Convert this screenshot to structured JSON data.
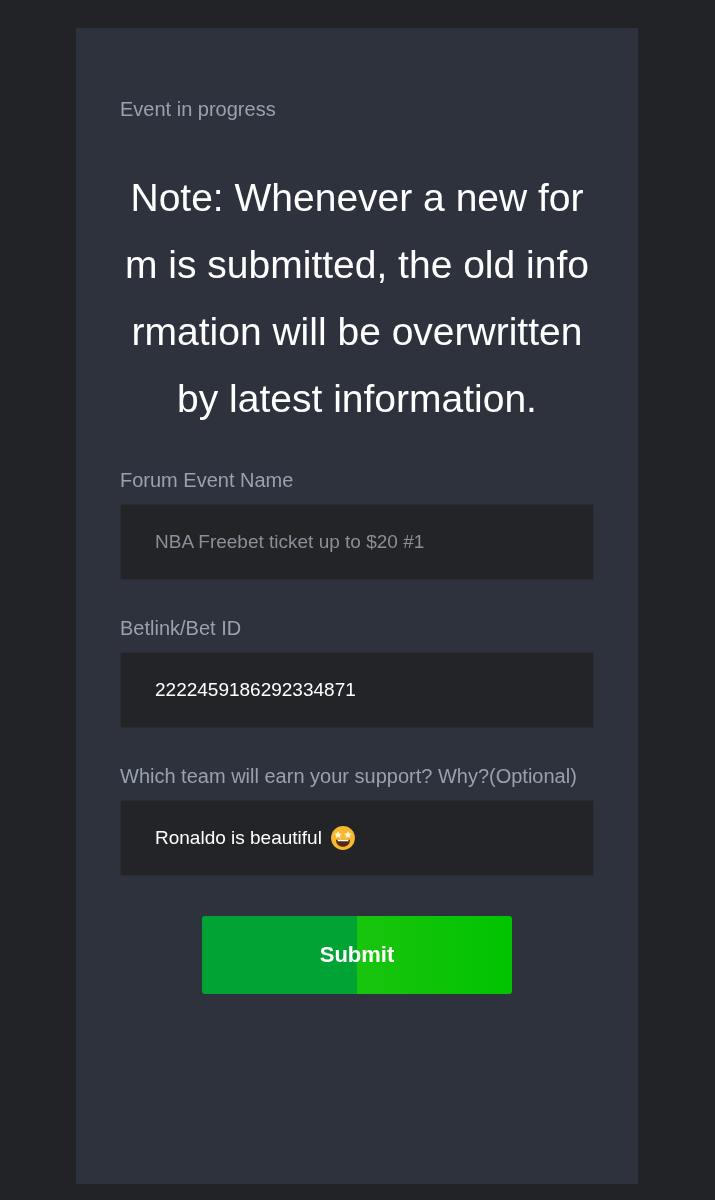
{
  "status": "Event in progress",
  "note": "Note: Whenever a new form is submitted, the old information will be overwritten by latest information.",
  "fields": [
    {
      "label": "Forum Event Name",
      "placeholder": "NBA Freebet ticket up to $20 #1"
    },
    {
      "label": "Betlink/Bet ID",
      "value": "2222459186292334871"
    },
    {
      "label": "Which team will earn your support? Why?(Optional)",
      "value": "Ronaldo is beautiful",
      "kind": "emoji"
    }
  ],
  "submit": "Submit"
}
